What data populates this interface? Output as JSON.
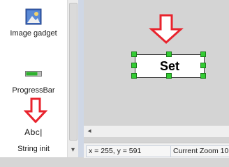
{
  "toolbox": {
    "items": [
      {
        "label": "Image gadget",
        "icon": "image-gadget-icon"
      },
      {
        "label": "ProgressBar",
        "icon": "progressbar-icon"
      },
      {
        "label": "Abc|",
        "icon": "string-init-icon"
      }
    ],
    "string_init_label": "String init"
  },
  "canvas": {
    "gadget_text": "Set"
  },
  "statusbar": {
    "coords": "x = 255, y = 591",
    "zoom": "Current Zoom 10"
  },
  "colors": {
    "annotation_arrow": "#e8232d",
    "selection_handle": "#33cc33",
    "statusbar_border": "#c8d0dc"
  }
}
